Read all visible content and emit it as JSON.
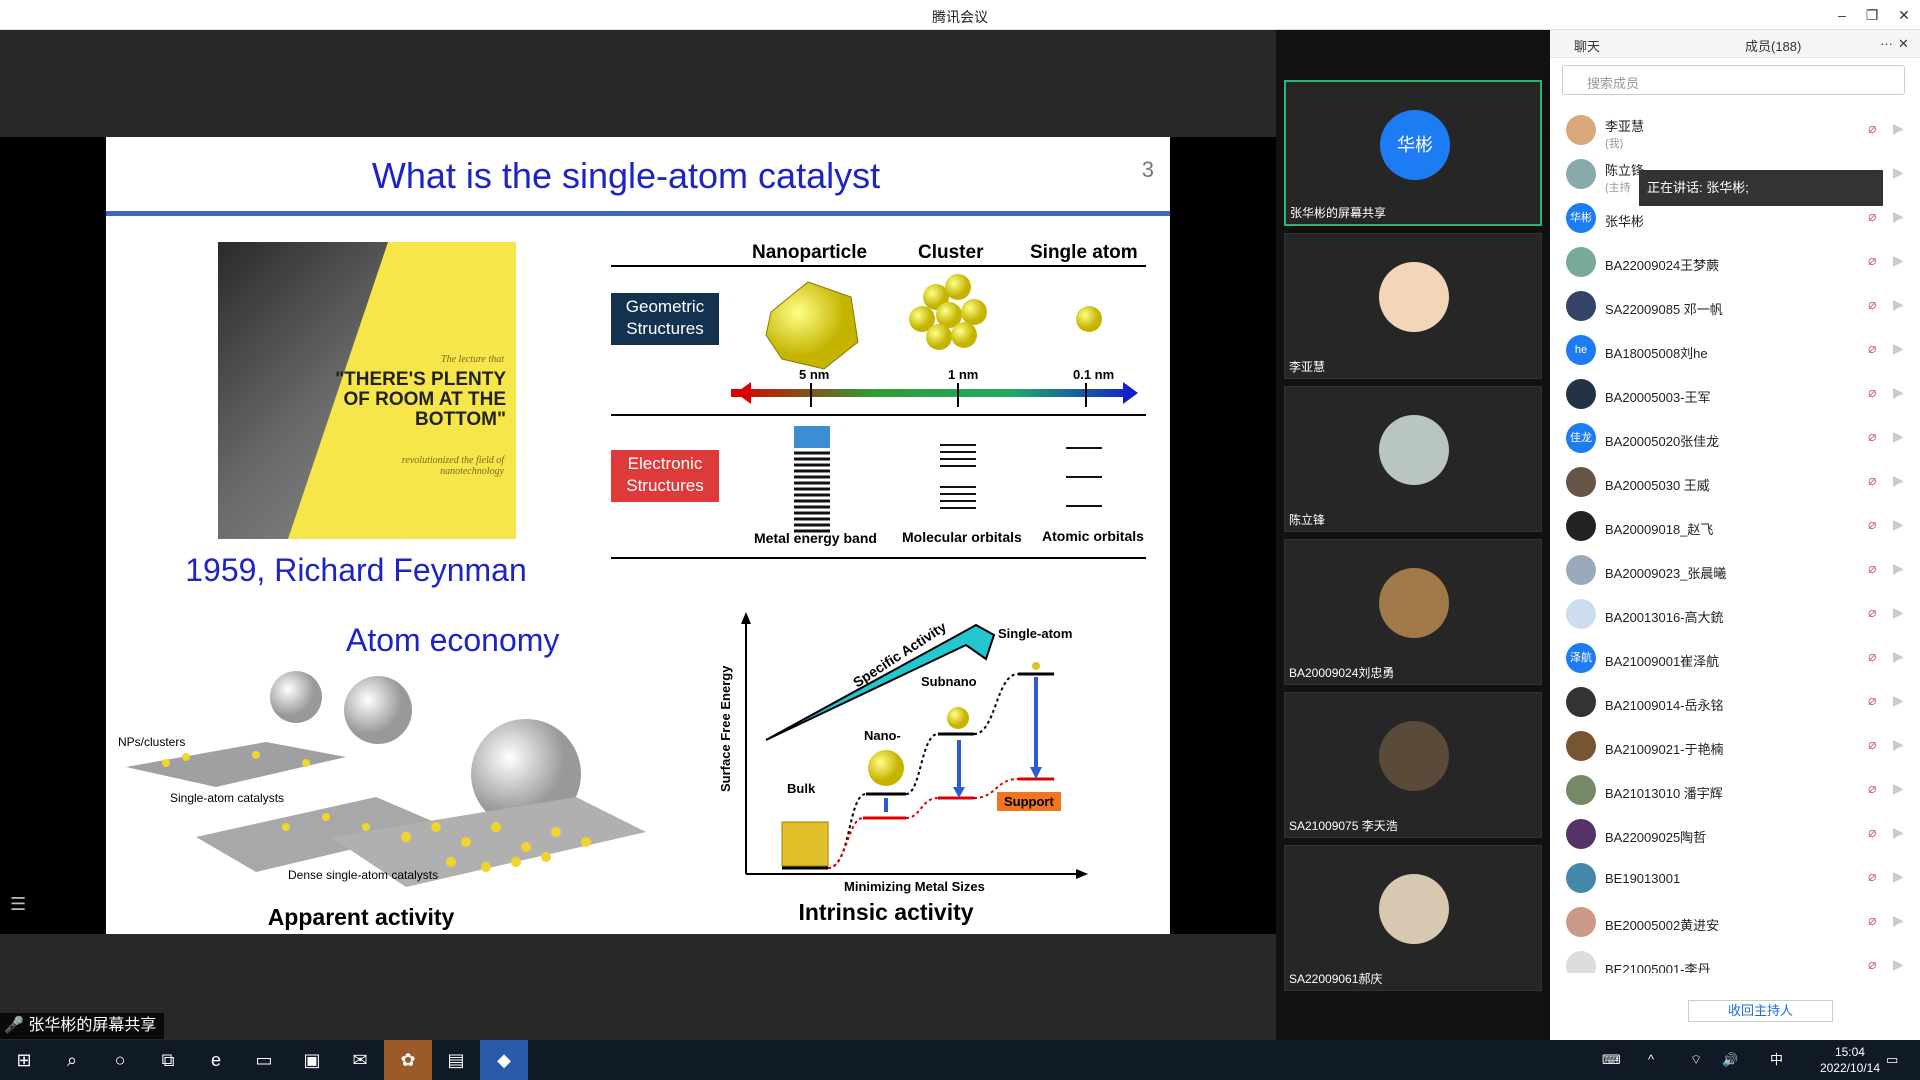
{
  "window": {
    "title": "腾讯会议",
    "minimize": "–",
    "restore": "❐",
    "close": "✕"
  },
  "slide": {
    "title": "What is the single-atom catalyst",
    "page_number": "3",
    "book": {
      "small": "The lecture that",
      "big": "\"THERE'S PLENTY OF ROOM AT THE BOTTOM\"",
      "foot": "revolutionized the field of nanotechnology"
    },
    "feynman": "1959, Richard Feynman",
    "atom_economy": "Atom economy",
    "table_headers": [
      "Nanoparticle",
      "Cluster",
      "Single atom"
    ],
    "geometric": "Geometric Structures",
    "electronic": "Electronic Structures",
    "sizes": [
      "5 nm",
      "1 nm",
      "0.1 nm"
    ],
    "orbitals": [
      "Metal energy band",
      "Molecular orbitals",
      "Atomic orbitals"
    ],
    "left_labels": [
      "NPs/clusters",
      "Single-atom catalysts",
      "Dense single-atom catalysts"
    ],
    "apparent": "Apparent activity",
    "intrinsic": "Intrinsic activity",
    "graph": {
      "ylabel": "Surface Free Energy",
      "xlabel": "Minimizing Metal Sizes",
      "arrow_label": "Specific Activity",
      "levels": [
        "Bulk",
        "Nano-",
        "Subnano",
        "Single-atom"
      ],
      "support": "Support"
    }
  },
  "share": {
    "label": "张华彬的屏幕共享"
  },
  "tiles": [
    {
      "name": "张华彬的屏幕共享",
      "avatar_text": "华彬"
    },
    {
      "name": "李亚慧"
    },
    {
      "name": "陈立锋"
    },
    {
      "name": "BA20009024刘忠勇"
    },
    {
      "name": "SA21009075 李天浩"
    },
    {
      "name": "SA22009061郝庆"
    }
  ],
  "panel": {
    "chat_tab": "聊天",
    "members_tab": "成员(188)",
    "search_placeholder": "搜索成员",
    "speaking": "正在讲话: 张华彬;",
    "reclaim": "收回主持人",
    "members": [
      {
        "name": "李亚慧",
        "sub": "(我)",
        "avatar": "#d9a77a"
      },
      {
        "name": "陈立锋",
        "sub": "(主持",
        "avatar": "#8aa"
      },
      {
        "name": "张华彬",
        "avatar": "#1e7cf2",
        "avatar_text": "华彬"
      },
      {
        "name": "BA22009024王梦蕨",
        "avatar": "#7a9"
      },
      {
        "name": "SA22009085 邓一帆",
        "avatar": "#346"
      },
      {
        "name": "BA18005008刘he",
        "avatar": "#1e7cf2",
        "avatar_text": "he"
      },
      {
        "name": "BA20005003-王军",
        "avatar": "#234"
      },
      {
        "name": "BA20005020张佳龙",
        "avatar": "#1e7cf2",
        "avatar_text": "佳龙"
      },
      {
        "name": "BA20005030 王威",
        "avatar": "#654"
      },
      {
        "name": "BA20009018_赵飞",
        "avatar": "#222"
      },
      {
        "name": "BA20009023_张晨曦",
        "avatar": "#9ab"
      },
      {
        "name": "BA20013016-高大銃",
        "avatar": "#cde"
      },
      {
        "name": "BA21009001崔泽航",
        "avatar": "#1e7cf2",
        "avatar_text": "泽航"
      },
      {
        "name": "BA21009014-岳永铭",
        "avatar": "#333"
      },
      {
        "name": "BA21009021-于艳楠",
        "avatar": "#753"
      },
      {
        "name": "BA21013010 潘宇辉",
        "avatar": "#786"
      },
      {
        "name": "BA22009025陶哲",
        "avatar": "#536"
      },
      {
        "name": "BE19013001",
        "avatar": "#48a"
      },
      {
        "name": "BE20005002黄进安",
        "avatar": "#c98"
      },
      {
        "name": "BE21005001-李丹",
        "avatar": "#ddd"
      }
    ]
  },
  "taskbar": {
    "time": "15:04",
    "date": "2022/10/14",
    "ime": "中"
  }
}
